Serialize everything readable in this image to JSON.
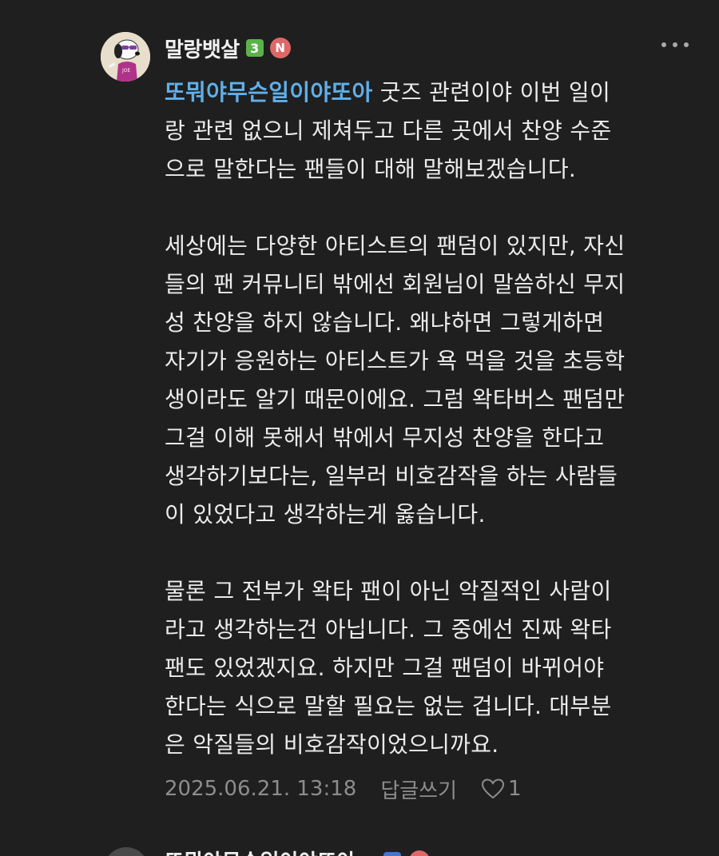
{
  "comment": {
    "author": {
      "nickname": "말랑뱃살",
      "level_badge": "3",
      "new_badge": "N",
      "avatar_icon": "snoopy-avatar-icon"
    },
    "mention": "또뭐야무슨일이야또아",
    "lines": [
      " 굿즈 관련이야 이번 일이",
      "랑 관련 없으니 제쳐두고 다른 곳에서 찬양 수준",
      "으로 말한다는 팬들이 대해 말해보겠습니다.",
      "",
      "세상에는 다양한 아티스트의 팬덤이 있지만, 자신",
      "들의 팬 커뮤니티 밖에선 회원님이 말씀하신 무지",
      "성 찬양을 하지 않습니다. 왜냐하면 그렇게하면",
      "자기가 응원하는 아티스트가 욕 먹을 것을 초등학",
      "생이라도 알기 때문이에요. 그럼 왁타버스 팬덤만",
      "그걸 이해 못해서 밖에서 무지성 찬양을 한다고",
      "생각하기보다는, 일부러 비호감작을 하는 사람들",
      "이 있었다고 생각하는게 옳습니다.",
      "",
      "물론 그 전부가 왁타 팬이 아닌 악질적인 사람이",
      "라고 생각하는건 아닙니다. 그 중에선 진짜 왁타",
      "팬도 있었겠지요. 하지만 그걸 팬덤이 바뀌어야",
      "한다는 식으로 말할 필요는 없는 겁니다. 대부분",
      "은 악질들의 비호감작이었으니까요."
    ],
    "timestamp": "2025.06.21. 13:18",
    "reply_label": "답글쓰기",
    "like_count": "1",
    "more_icon": "more-dots-icon",
    "like_icon": "heart-outline-icon"
  },
  "next_comment": {
    "nickname": "또뭐야무슨일이야또아"
  },
  "colors": {
    "background": "#1f1f1f",
    "text": "#ececec",
    "mention": "#5fb0ea",
    "meta": "#8d8d8d",
    "level_badge": "#5bb24a",
    "new_badge": "#e06767"
  }
}
